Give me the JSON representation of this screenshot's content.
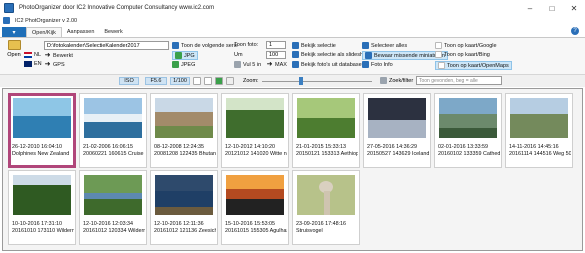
{
  "window": {
    "title": "PhotoOrganizer door IC2 Innovative Computer Consultancy www.ic2.com",
    "version": "IC2 PhotOrganizer v 2.00",
    "minimize": "–",
    "maximize": "□",
    "close": "✕"
  },
  "menu": {
    "app_button": "▾",
    "tabs": [
      "Open/Kijk",
      "Aanpassen",
      "Bewerk"
    ],
    "help": "?"
  },
  "ribbon": {
    "open_label": "Open",
    "nl_label": "NL",
    "en_label": "EN",
    "path_value": "D:\\fotokalender\\SelectieKalender2017",
    "bewerkt": "Bewerkt",
    "gps": "GPS",
    "toon_volgende_serie": "Toon de volgende serie",
    "jpg1": "JPG",
    "jpeg": "JPEG",
    "toon_foto_label": "Toon foto:",
    "toon_foto_value": "1",
    "um_label": "Um",
    "um_value": "100",
    "vul_label": "Vul 5 in",
    "max_label": "MAX",
    "bekijk_selectie": "Bekijk selectie",
    "bekijk_slideshow": "Bekijk selectie als slideshow",
    "bekijk_database": "Bekijk foto's uit database",
    "selecteer_alles": "Selecteer alles",
    "bewaar_miniaturen": "Bewaar missende miniaturen",
    "foto_info": "Foto Info",
    "kaart_google": "Toon op kaart/Google",
    "kaart_bing": "Toon op kaart/Bing",
    "kaart_osm": "Toon op kaart/OpenMaps"
  },
  "toolbar": {
    "iso": "ISO",
    "fstop": "F5.6",
    "shutter": "1/100",
    "zoom_label": "Zoom:",
    "zoom_level": 0.35,
    "search_label": "Zoek/filter",
    "search_placeholder": "Toon gevonden, beg = alle"
  },
  "photos": [
    {
      "date": "26-12-2010 16:04:10",
      "name": "Dolphines New Zealand",
      "selected": true,
      "scene": "sea"
    },
    {
      "date": "21-02-2006 16:06:15",
      "name": "20060221 160615 Cruise -",
      "selected": false,
      "scene": "glacier"
    },
    {
      "date": "08-12-2008 12:24:35",
      "name": "20081208 122435 Bhutan -",
      "selected": false,
      "scene": "temple"
    },
    {
      "date": "12-10-2012 14:10:20",
      "name": "20121012 141020 Witte n",
      "selected": false,
      "scene": "forest"
    },
    {
      "date": "21-01-2015 15:33:13",
      "name": "20150121 153313 Aethiop",
      "selected": false,
      "scene": "garden"
    },
    {
      "date": "27-05-2016 14:36:29",
      "name": "20150527 143629 Iceland",
      "selected": false,
      "scene": "dusk"
    },
    {
      "date": "02-01-2016 13:33:59",
      "name": "20160102 133359 Cathedr",
      "selected": false,
      "scene": "landscape"
    },
    {
      "date": "14-11-2016 14:45:16",
      "name": "20161114 144516 Weg 50",
      "selected": false,
      "scene": "road"
    },
    {
      "date": "10-10-2016 17:31:10",
      "name": "20161010 173110 Wildern",
      "selected": false,
      "scene": "trees"
    },
    {
      "date": "12-10-2016 12:03:34",
      "name": "20161012 120334 Wildern",
      "selected": false,
      "scene": "river"
    },
    {
      "date": "12-10-2016 12:11:36",
      "name": "20161012 121136 Zeesicht",
      "selected": false,
      "scene": "coast"
    },
    {
      "date": "15-10-2016 15:53:05",
      "name": "20161015 155305 Agulhas",
      "selected": false,
      "scene": "sunset"
    },
    {
      "date": "23-09-2016 17:48:16",
      "name": "Struisvogel",
      "selected": false,
      "scene": "ostrich"
    }
  ],
  "colors": {
    "selection_border": "#b0467a",
    "ribbon_highlight": "#cde6f7",
    "menu_button": "#1f6fb8"
  }
}
